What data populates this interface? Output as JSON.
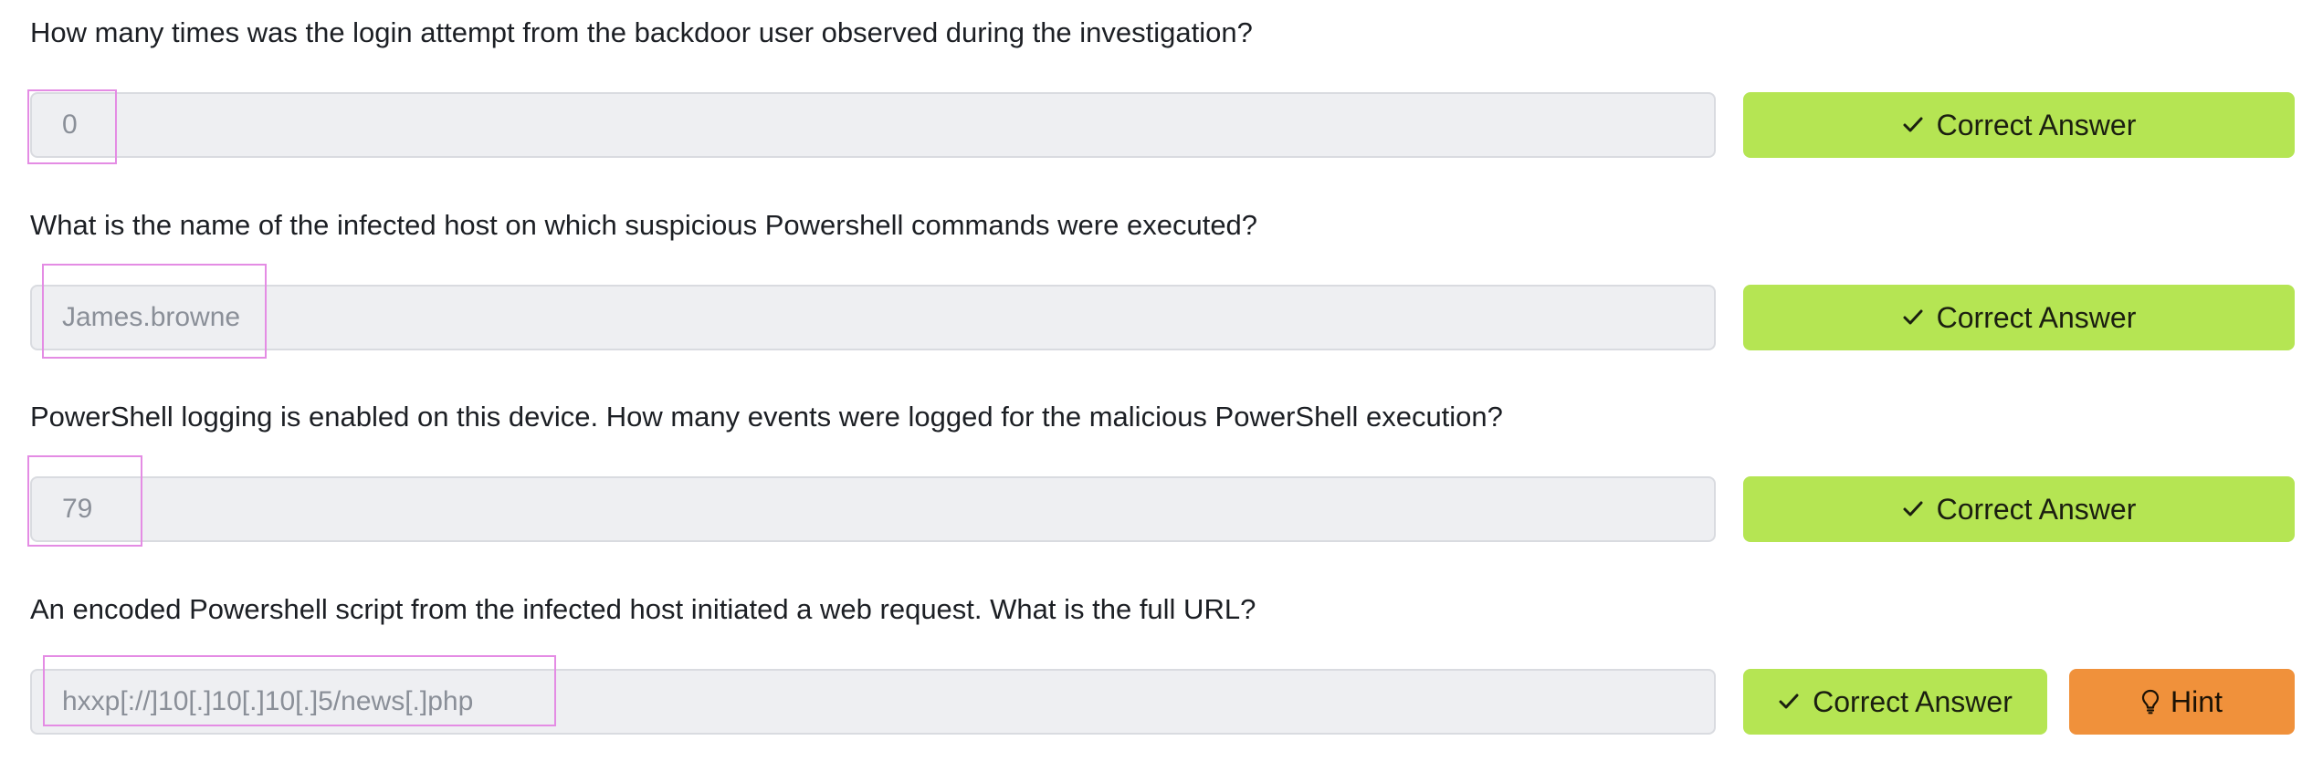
{
  "questions": [
    {
      "text": "How many times was the login attempt from the backdoor user observed during the investigation?",
      "answer": "0",
      "correct_label": "Correct Answer"
    },
    {
      "text": "What is the name of the infected host on which suspicious Powershell commands were executed?",
      "answer": "James.browne",
      "correct_label": "Correct Answer"
    },
    {
      "text": "PowerShell logging is enabled on this device. How many events were logged for the malicious PowerShell execution?",
      "answer": "79",
      "correct_label": "Correct Answer"
    },
    {
      "text": "An encoded Powershell script from the infected host initiated a web request. What is the full URL?",
      "answer": "hxxp[://]10[.]10[.]10[.]5/news[.]php",
      "correct_label": "Correct Answer",
      "hint_label": "Hint"
    }
  ],
  "icons": {
    "correct": "check-icon",
    "hint": "lightbulb-icon"
  },
  "colors": {
    "correct_button": "#b5e553",
    "hint_button": "#f0913b",
    "answer_field": "#eeeff2",
    "highlight": "#e48ce4"
  }
}
